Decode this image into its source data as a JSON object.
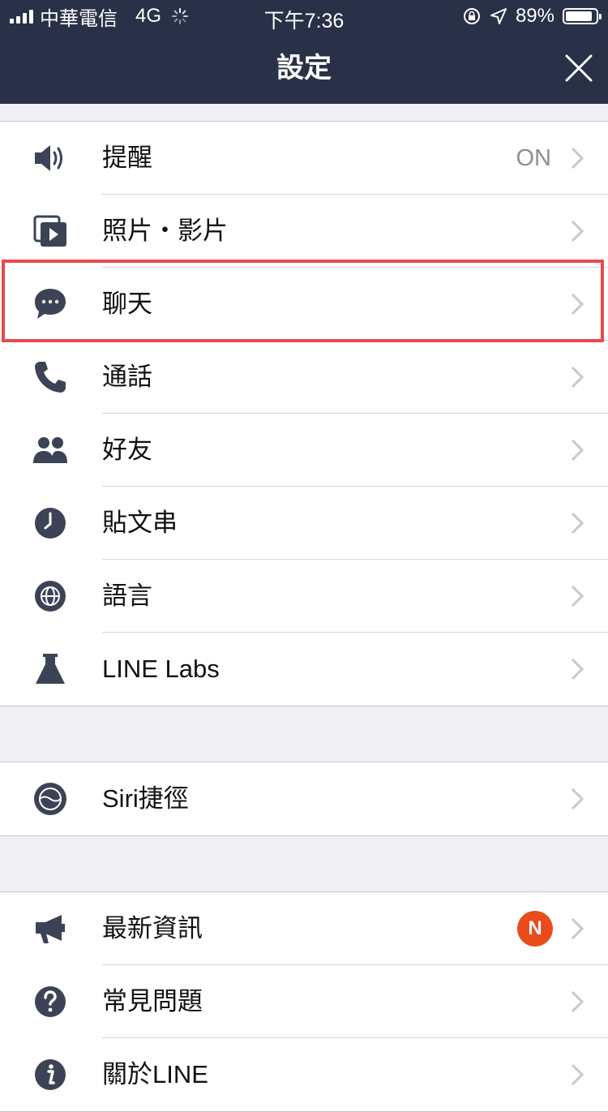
{
  "status_bar": {
    "carrier": "中華電信",
    "network": "4G",
    "time": "下午7:36",
    "battery_percent": "89%",
    "battery_level": 0.89
  },
  "header": {
    "title": "設定",
    "close_icon": "close-icon"
  },
  "colors": {
    "nav_background": "#283147",
    "icon": "#3c4356",
    "highlight": "#e84a4f",
    "badge": "#e94c1a"
  },
  "settings_group_1": [
    {
      "label": "提醒",
      "value": "ON",
      "icon": "speaker-icon"
    },
    {
      "label": "照片・影片",
      "icon": "photo-video-icon"
    },
    {
      "label": "聊天",
      "icon": "chat-bubble-icon",
      "highlighted": true
    },
    {
      "label": "通話",
      "icon": "phone-icon"
    },
    {
      "label": "好友",
      "icon": "friends-icon"
    },
    {
      "label": "貼文串",
      "icon": "clock-icon"
    },
    {
      "label": "語言",
      "icon": "globe-icon"
    },
    {
      "label": "LINE Labs",
      "icon": "flask-icon"
    }
  ],
  "settings_group_2": [
    {
      "label": "Siri捷徑",
      "icon": "siri-icon"
    }
  ],
  "settings_group_3": [
    {
      "label": "最新資訊",
      "badge": "N",
      "icon": "megaphone-icon"
    },
    {
      "label": "常見問題",
      "icon": "question-icon"
    },
    {
      "label": "關於LINE",
      "icon": "info-icon"
    }
  ]
}
